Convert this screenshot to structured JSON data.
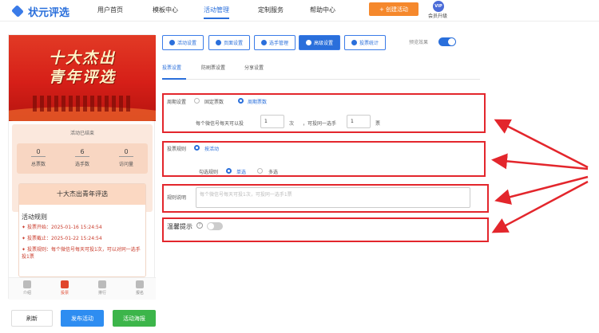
{
  "header": {
    "logo_text": "状元评选",
    "nav": [
      "用户首页",
      "模板中心",
      "活动管理",
      "定制服务",
      "帮助中心"
    ],
    "create_button": "+ 创建活动",
    "vip_badge": "VIP",
    "vip_label": "会员升级"
  },
  "preview": {
    "banner_line1": "十大杰出",
    "banner_line2": "青年评选",
    "status": "活动已结束",
    "stats": [
      {
        "value": "0",
        "label": "总票数"
      },
      {
        "value": "6",
        "label": "选手数"
      },
      {
        "value": "0",
        "label": "访问量"
      }
    ],
    "activity_title": "十大杰出青年评选",
    "rules_title": "活动规则",
    "rules": [
      {
        "label": "投票开始：",
        "text": "2025-01-16 15:24:54"
      },
      {
        "label": "投票截止：",
        "text": "2025-01-22 15:24:54"
      },
      {
        "label": "投票规则：",
        "text": "每个微信号每天可投1次，可以对同一选手投1票"
      }
    ],
    "tabbar": [
      "介绍",
      "投票",
      "排行",
      "报名"
    ]
  },
  "bottom_buttons": {
    "refresh": "刷新",
    "publish": "发布活动",
    "poster": "活动海报"
  },
  "toolbar": {
    "buttons": [
      "活动设置",
      "页面设置",
      "选手管理",
      "高级设置",
      "投票统计"
    ],
    "preview_label": "预览效果"
  },
  "subtabs": [
    "投票设置",
    "防刷票设置",
    "分享设置"
  ],
  "settings": {
    "period_label": "周期设置",
    "period_options": [
      "固定票数",
      "周期票数"
    ],
    "per_day_prefix": "每个微信号每天可以投",
    "per_day_value": "1",
    "times_unit": "次",
    "same_player_prefix": "，可投同一选手",
    "same_player_value": "1",
    "vote_unit": "票",
    "rule_label": "投票规则",
    "rule_option": "按活动",
    "select_rule_label": "勾选规则",
    "select_options": [
      "单选",
      "多选"
    ],
    "rule_desc_label": "规则说明",
    "rule_desc_placeholder": "每个微信号每天可投1次，可投同一选手1票",
    "tip_label": "温馨提示",
    "help_icon_text": "?"
  }
}
